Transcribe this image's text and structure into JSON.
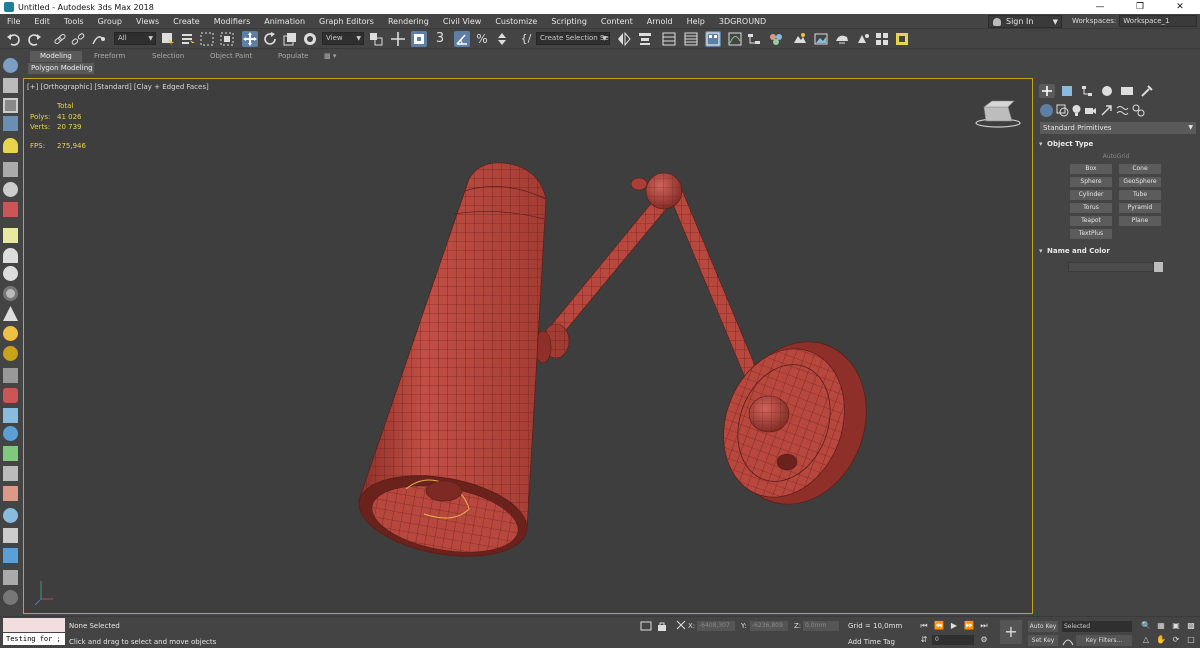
{
  "window": {
    "title": "Untitled - Autodesk 3ds Max 2018"
  },
  "menu": {
    "items": [
      "File",
      "Edit",
      "Tools",
      "Group",
      "Views",
      "Create",
      "Modifiers",
      "Animation",
      "Graph Editors",
      "Rendering",
      "Civil View",
      "Customize",
      "Scripting",
      "Content",
      "Arnold",
      "Help",
      "3DGROUND"
    ],
    "sign_in": "Sign In",
    "workspaces_label": "Workspaces:",
    "workspace_value": "Workspace_1"
  },
  "toolbar": {
    "selection_filter": "All",
    "ref_coord": "View",
    "snap_label": "3",
    "named_selection": "Create Selection Se"
  },
  "ribbon": {
    "tabs": [
      "Modeling",
      "Freeform",
      "Selection",
      "Object Paint",
      "Populate"
    ],
    "active_tab": "Modeling",
    "panel_label": "Polygon Modeling"
  },
  "viewport": {
    "label": "[+] [Orthographic] [Standard] [Clay + Edged Faces]",
    "stats": {
      "total_label": "Total",
      "polys_label": "Polys:",
      "polys_value": "41 026",
      "verts_label": "Verts:",
      "verts_value": "20 739",
      "fps_label": "FPS:",
      "fps_value": "275,946"
    },
    "colors": {
      "mesh": "#b8473e",
      "wire": "#5a1c17",
      "frame": "#c8a21a"
    }
  },
  "command_panel": {
    "category_dropdown": "Standard Primitives",
    "object_type_title": "Object Type",
    "autogrid": "AutoGrid",
    "object_buttons": [
      "Box",
      "Cone",
      "Sphere",
      "GeoSphere",
      "Cylinder",
      "Tube",
      "Torus",
      "Pyramid",
      "Teapot",
      "Plane",
      "TextPlus"
    ],
    "name_color_title": "Name and Color"
  },
  "status": {
    "maxscript_input": "Testing for ;",
    "selection_status": "None Selected",
    "prompt": "Click and drag to select and move objects",
    "x_label": "X:",
    "x_value": "-6408,307",
    "y_label": "Y:",
    "y_value": "-6236,809",
    "z_label": "Z:",
    "z_value": "0,0mm",
    "grid": "Grid = 10,0mm",
    "add_time_tag": "Add Time Tag",
    "frame": "0",
    "auto_key": "Auto Key",
    "set_key": "Set Key",
    "selected_dropdown": "Selected",
    "key_filters": "Key Filters..."
  }
}
